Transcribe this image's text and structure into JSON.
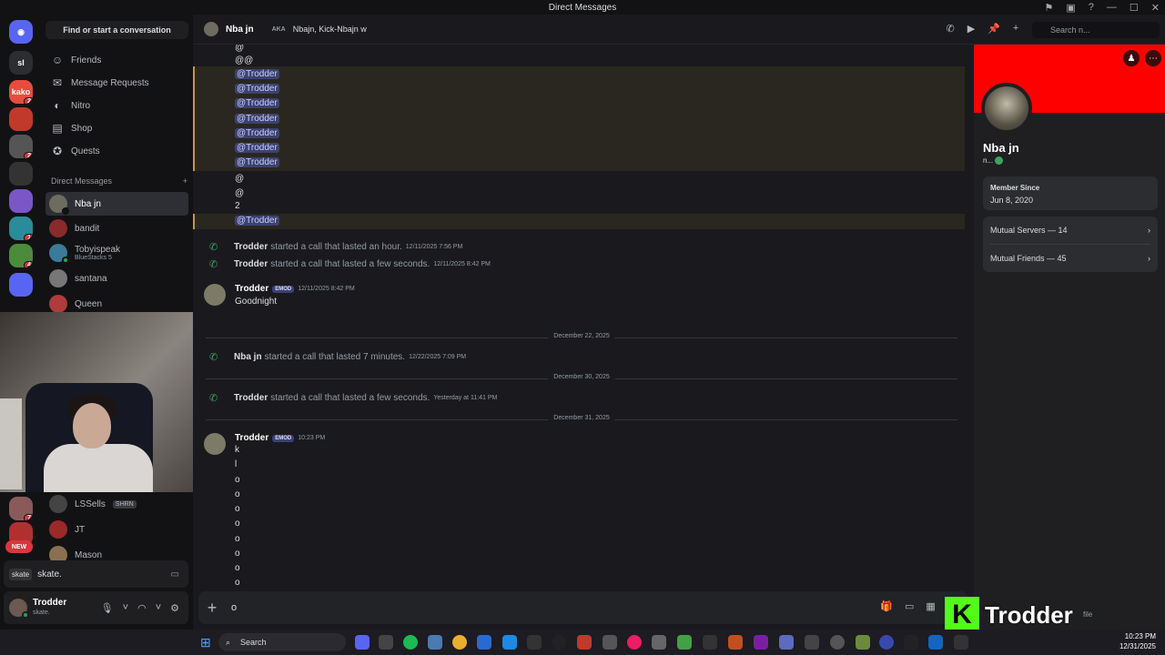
{
  "window": {
    "title": "Direct Messages"
  },
  "dm_column": {
    "find_label": "Find or start a conversation",
    "nav": [
      {
        "label": "Friends",
        "icon": "friends-icon"
      },
      {
        "label": "Message Requests",
        "icon": "mail-icon"
      },
      {
        "label": "Nitro",
        "icon": "nitro-icon"
      },
      {
        "label": "Shop",
        "icon": "shop-icon"
      },
      {
        "label": "Quests",
        "icon": "quests-icon"
      }
    ],
    "dm_header": "Direct Messages",
    "dms": [
      {
        "name": "Nba jn"
      },
      {
        "name": "bandit"
      },
      {
        "name": "Tobyispeak",
        "sub": "BlueStacks 5"
      },
      {
        "name": "santana"
      },
      {
        "name": "Queen"
      },
      {
        "name": "LSSells",
        "tag": "SHRN"
      },
      {
        "name": "JT"
      },
      {
        "name": "Mason"
      }
    ]
  },
  "servers": [
    {
      "label": "sl"
    },
    {
      "label": "kako",
      "badge": "2"
    },
    {
      "label": "",
      "badge": ""
    },
    {
      "label": "",
      "badge": "2"
    },
    {
      "label": "",
      "badge": ""
    },
    {
      "label": "",
      "badge": ""
    },
    {
      "label": "",
      "badge": "1"
    },
    {
      "label": "",
      "badge": "4"
    },
    {
      "label": "",
      "badge": "7"
    },
    {
      "label": "NEW"
    }
  ],
  "activity": {
    "app": "skate",
    "text": "skate."
  },
  "user": {
    "name": "Trodder",
    "status": "skate."
  },
  "header": {
    "name": "Nba jn",
    "aka_label": "AKA",
    "aka": "Nbajn, Kick-Nbajn w",
    "search_placeholder": "Search n..."
  },
  "messages": {
    "top_lines": [
      "@",
      "@@"
    ],
    "mentions": [
      "@Trodder",
      "@Trodder",
      "@Trodder",
      "@Trodder",
      "@Trodder",
      "@Trodder",
      "@Trodder"
    ],
    "mid_lines": [
      "@",
      "@",
      "2"
    ],
    "last_mention": "@Trodder",
    "calls": [
      {
        "who": "Trodder",
        "text": "started a call that lasted an hour.",
        "ts": "12/11/2025 7:56 PM"
      },
      {
        "who": "Trodder",
        "text": "started a call that lasted a few seconds.",
        "ts": "12/11/2025 8:42 PM"
      }
    ],
    "msg1": {
      "author": "Trodder",
      "tag": "EMOD",
      "ts": "12/11/2025 8:42 PM",
      "text": "Goodnight"
    },
    "div1": "December 22, 2025",
    "call3": {
      "who": "Nba jn",
      "text": "started a call that lasted 7 minutes.",
      "ts": "12/22/2025 7:09 PM"
    },
    "div2": "December 30, 2025",
    "call4": {
      "who": "Trodder",
      "text": "started a call that lasted a few seconds.",
      "ts": "Yesterday at 11:41 PM"
    },
    "div3": "December 31, 2025",
    "msg2": {
      "author": "Trodder",
      "tag": "EMOD",
      "ts": "10:23 PM",
      "lines": [
        "k",
        "l",
        "o",
        "o",
        "o",
        "o",
        "o",
        "o",
        "o",
        "o"
      ]
    }
  },
  "composer": {
    "value": "o"
  },
  "profile": {
    "name": "Nba jn",
    "username": "n...",
    "member_since_label": "Member Since",
    "member_since": "Jun 8, 2020",
    "mutual_servers": "Mutual Servers — 14",
    "mutual_friends": "Mutual Friends — 45",
    "footer": "file"
  },
  "overlay": {
    "logo": "K",
    "streamer": "Trodder"
  },
  "taskbar": {
    "search": "Search",
    "time": "10:23 PM",
    "date": "12/31/2025"
  }
}
